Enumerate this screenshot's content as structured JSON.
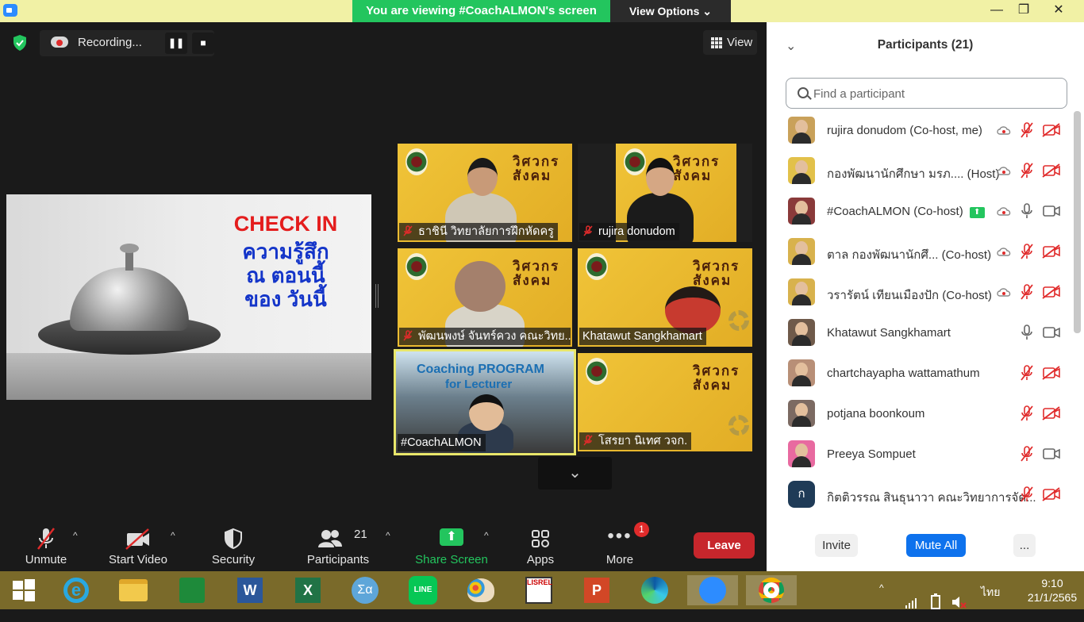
{
  "topbar": {
    "viewing_text": "You are viewing #CoachALMON's screen",
    "view_options": "View Options ⌄",
    "minimize": "—",
    "maximize": "❐",
    "close": "✕"
  },
  "stage": {
    "recording_label": "Recording...",
    "pause": "❚❚",
    "stop": "■",
    "view_label": "View",
    "expand_chevron": "⌄"
  },
  "slide": {
    "title": "CHECK IN",
    "line1": "ความรู้สึก",
    "line2": "ณ ตอนนี้",
    "line3": "ของ วันนี้"
  },
  "tiles": [
    {
      "name": "ธาชินี  วิทยาลัยการฝึกหัดครู",
      "muted": true,
      "brand": "วิศวกร\nสังคม"
    },
    {
      "name": "rujira donudom",
      "muted": true,
      "brand": "วิศวกร\nสังคม"
    },
    {
      "name": "พัฒนพงษ์ จันทร์ควง คณะวิทย...",
      "muted": true,
      "brand": "วิศวกร\nสังคม"
    },
    {
      "name": "Khatawut Sangkhamart",
      "muted": false,
      "brand": "วิศวกร\nสังคม"
    },
    {
      "name": "#CoachALMON",
      "muted": false,
      "brand": "Coaching PROGRAM for Lecturer"
    },
    {
      "name": "โสรยา นิเทศ วจก.",
      "muted": true,
      "brand": "วิศวกร\nสังคม"
    }
  ],
  "toolbar": {
    "unmute": "Unmute",
    "start_video": "Start Video",
    "security": "Security",
    "participants": "Participants",
    "participants_count": "21",
    "share_screen": "Share Screen",
    "apps": "Apps",
    "more": "More",
    "more_badge": "1",
    "leave": "Leave",
    "caret": "^"
  },
  "panel": {
    "title": "Participants (21)",
    "search_placeholder": "Find a participant",
    "participants": [
      {
        "name": "rujira donudom (Co-host, me)",
        "rec": true,
        "mic": "off",
        "video": "off",
        "sharing": false
      },
      {
        "name": "กองพัฒนานักศึกษา มรภ.... (Host)",
        "rec": true,
        "mic": "off",
        "video": "off",
        "sharing": false
      },
      {
        "name": "#CoachALMON (Co-host)",
        "rec": true,
        "mic": "on",
        "video": "on",
        "sharing": true
      },
      {
        "name": "ตาล กองพัฒนานักศึ...   (Co-host)",
        "rec": true,
        "mic": "off",
        "video": "off",
        "sharing": false
      },
      {
        "name": "วรารัตน์ เทียนเมืองปัก (Co-host)",
        "rec": true,
        "mic": "off",
        "video": "off",
        "sharing": false
      },
      {
        "name": "Khatawut Sangkhamart",
        "rec": false,
        "mic": "on",
        "video": "on",
        "sharing": false
      },
      {
        "name": "chartchayapha wattamathum",
        "rec": false,
        "mic": "off",
        "video": "off",
        "sharing": false
      },
      {
        "name": "potjana boonkoum",
        "rec": false,
        "mic": "off",
        "video": "off",
        "sharing": false
      },
      {
        "name": "Preeya Sompuet",
        "rec": false,
        "mic": "off",
        "video": "on",
        "sharing": false
      },
      {
        "name": "กิตติวรรณ สินธุนาวา คณะวิทยาการจัด...",
        "rec": false,
        "mic": "off",
        "video": "off",
        "sharing": false,
        "initial": "ก"
      }
    ],
    "invite": "Invite",
    "mute_all": "Mute All",
    "more": "..."
  },
  "taskbar": {
    "apps": [
      "start",
      "internet-explorer",
      "file-explorer",
      "store",
      "word",
      "excel",
      "math-input",
      "line",
      "paint",
      "lisrel",
      "powerpoint",
      "edge",
      "zoom",
      "chrome"
    ],
    "tray_arrow": "^",
    "language": "ไทย",
    "time": "9:10",
    "date": "21/1/2565"
  },
  "colors": {
    "accent_green": "#23c55e",
    "leave_red": "#c7262c",
    "mute_red": "#e02b2b",
    "tile_yellow": "#e9b833",
    "taskbar": "#7a6a2a"
  }
}
